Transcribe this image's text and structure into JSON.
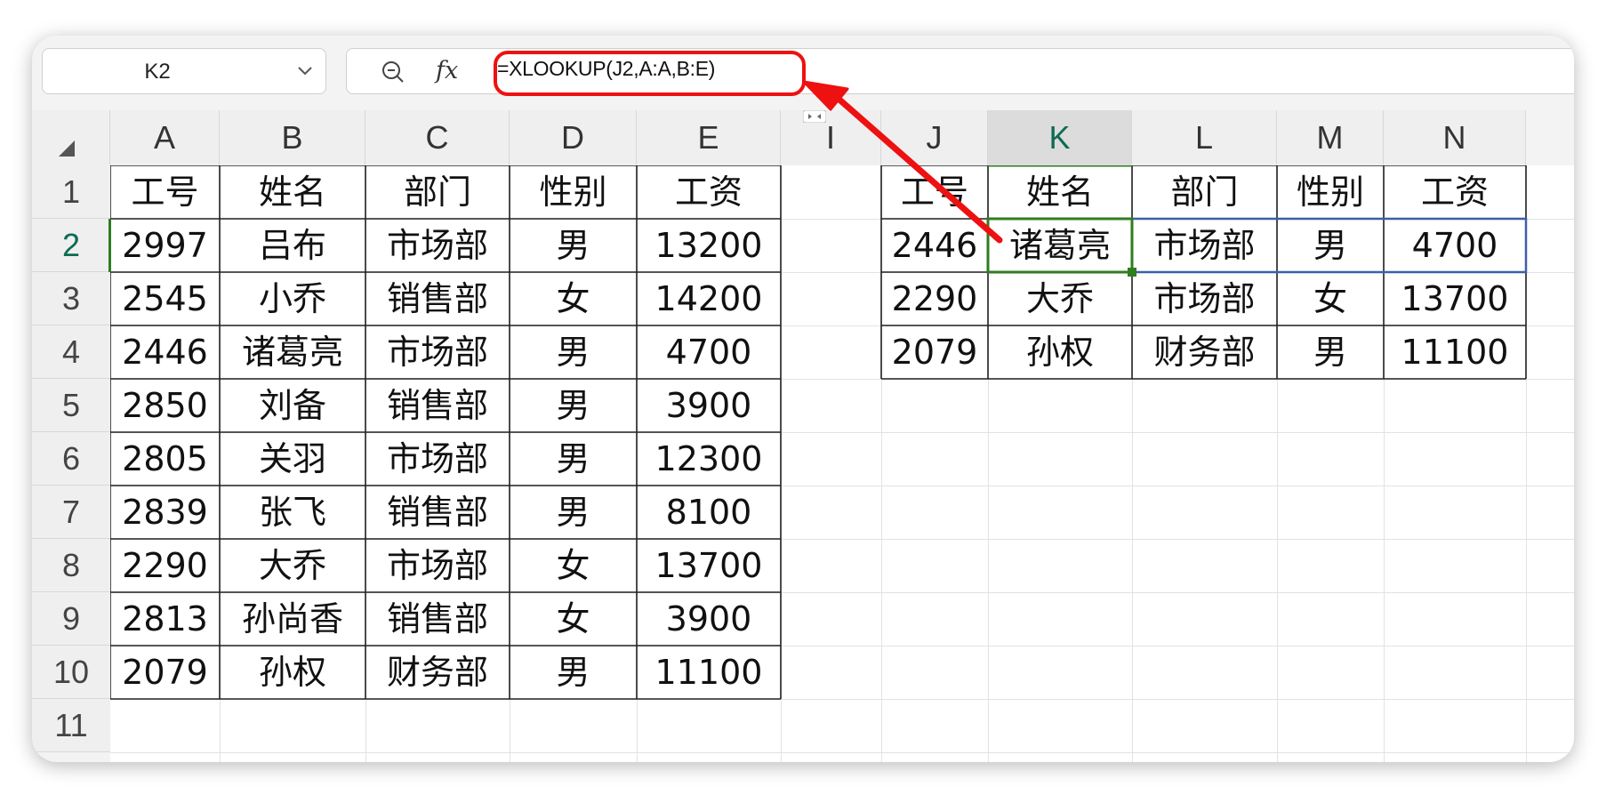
{
  "name_box": {
    "value": "K2",
    "icon": "chevron-down-icon"
  },
  "formula_bar": {
    "zoom_icon": "zoom-out-icon",
    "fx_label": "fx",
    "formula": "=XLOOKUP(J2,A:A,B:E)"
  },
  "columns": [
    "A",
    "B",
    "C",
    "D",
    "E",
    "I",
    "J",
    "K",
    "L",
    "M",
    "N"
  ],
  "selected_column": "K",
  "rows": [
    "1",
    "2",
    "3",
    "4",
    "5",
    "6",
    "7",
    "8",
    "9",
    "10",
    "11"
  ],
  "selected_row": "2",
  "left_table": {
    "header": [
      "工号",
      "姓名",
      "部门",
      "性别",
      "工资"
    ],
    "rows": [
      [
        "2997",
        "吕布",
        "市场部",
        "男",
        "13200"
      ],
      [
        "2545",
        "小乔",
        "销售部",
        "女",
        "14200"
      ],
      [
        "2446",
        "诸葛亮",
        "市场部",
        "男",
        "4700"
      ],
      [
        "2850",
        "刘备",
        "销售部",
        "男",
        "3900"
      ],
      [
        "2805",
        "关羽",
        "市场部",
        "男",
        "12300"
      ],
      [
        "2839",
        "张飞",
        "销售部",
        "男",
        "8100"
      ],
      [
        "2290",
        "大乔",
        "市场部",
        "女",
        "13700"
      ],
      [
        "2813",
        "孙尚香",
        "销售部",
        "女",
        "3900"
      ],
      [
        "2079",
        "孙权",
        "财务部",
        "男",
        "11100"
      ]
    ]
  },
  "right_table": {
    "header": [
      "工号",
      "姓名",
      "部门",
      "性别",
      "工资"
    ],
    "rows": [
      [
        "2446",
        "诸葛亮",
        "市场部",
        "男",
        "4700"
      ],
      [
        "2290",
        "大乔",
        "市场部",
        "女",
        "13700"
      ],
      [
        "2079",
        "孙权",
        "财务部",
        "男",
        "11100"
      ]
    ]
  },
  "colors": {
    "selection_green": "#2f7d1f",
    "spill_blue": "#3b5fa8",
    "annotation_red": "#ee1111",
    "selected_header_text": "#0e6b52"
  }
}
